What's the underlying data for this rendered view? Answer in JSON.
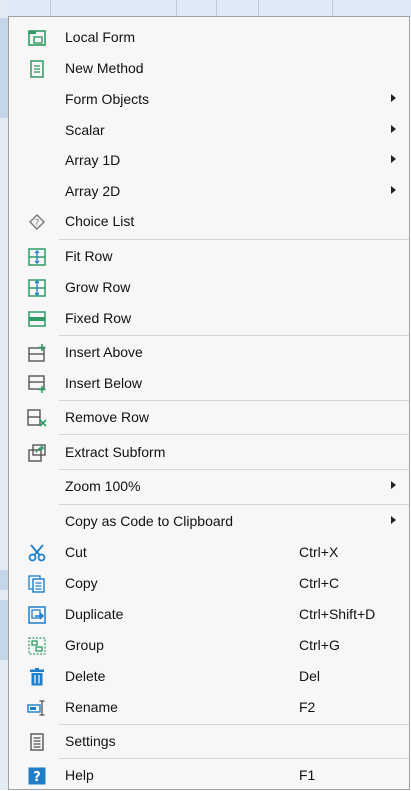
{
  "menu": {
    "items": [
      {
        "label": "Local Form",
        "icon": "local-form-icon"
      },
      {
        "label": "New Method",
        "icon": "new-method-icon"
      },
      {
        "label": "Form Objects",
        "submenu": true
      },
      {
        "label": "Scalar",
        "submenu": true
      },
      {
        "label": "Array 1D",
        "submenu": true
      },
      {
        "label": "Array 2D",
        "submenu": true
      },
      {
        "label": "Choice List",
        "icon": "choice-list-icon"
      },
      {
        "label": "Fit Row",
        "icon": "fit-row-icon"
      },
      {
        "label": "Grow Row",
        "icon": "grow-row-icon"
      },
      {
        "label": "Fixed Row",
        "icon": "fixed-row-icon"
      },
      {
        "label": "Insert Above",
        "icon": "insert-above-icon"
      },
      {
        "label": "Insert Below",
        "icon": "insert-below-icon"
      },
      {
        "label": "Remove Row",
        "icon": "remove-row-icon"
      },
      {
        "label": "Extract Subform",
        "icon": "extract-subform-icon"
      },
      {
        "label": "Zoom 100%",
        "submenu": true
      },
      {
        "label": "Copy as Code to Clipboard",
        "submenu": true
      },
      {
        "label": "Cut",
        "shortcut": "Ctrl+X",
        "icon": "scissors-icon"
      },
      {
        "label": "Copy",
        "shortcut": "Ctrl+C",
        "icon": "copy-icon"
      },
      {
        "label": "Duplicate",
        "shortcut": "Ctrl+Shift+D",
        "icon": "duplicate-icon"
      },
      {
        "label": "Group",
        "shortcut": "Ctrl+G",
        "icon": "group-icon"
      },
      {
        "label": "Delete",
        "shortcut": "Del",
        "icon": "trash-icon"
      },
      {
        "label": "Rename",
        "shortcut": "F2",
        "icon": "rename-icon"
      },
      {
        "label": "Settings",
        "icon": "settings-icon"
      },
      {
        "label": "Help",
        "shortcut": "F1",
        "icon": "help-icon"
      }
    ]
  },
  "colors": {
    "accent": "#1e7ec8",
    "green": "#2e9b63",
    "menu_bg": "#f7f7f7"
  }
}
